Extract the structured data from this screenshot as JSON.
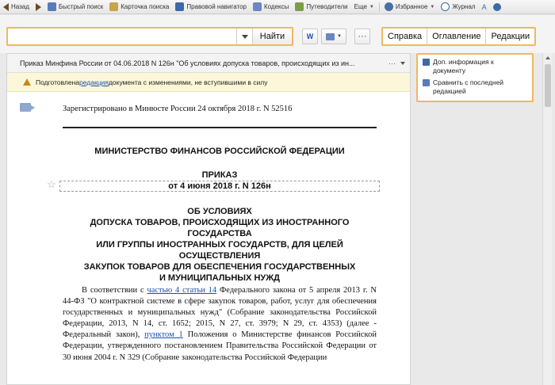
{
  "toolbar": {
    "back": "Назад",
    "quick_search": "Быстрый поиск",
    "search_card": "Карточка поиска",
    "legal_navigator": "Правовой навигатор",
    "codes": "Кодексы",
    "guides": "Путеводители",
    "more": "Еще",
    "favorites": "Избранное",
    "journal": "Журнал",
    "font_size": "A"
  },
  "search": {
    "value": "",
    "find_label": "Найти",
    "word_icon_label": "W"
  },
  "tabs": [
    "Справка",
    "Оглавление",
    "Редакции"
  ],
  "doc_title": "Приказ Минфина России от 04.06.2018 N 126н \"Об условиях допуска товаров, происходящих из ин...",
  "warning": {
    "prefix": "Подготовлена ",
    "link": "редакция",
    "suffix": " документа с изменениями, не вступившими в силу"
  },
  "document": {
    "registered": "Зарегистрировано в Минюсте России 24 октября 2018 г. N 52516",
    "ministry": "МИНИСТЕРСТВО ФИНАНСОВ РОССИЙСКОЙ ФЕДЕРАЦИИ",
    "order": "ПРИКАЗ",
    "order_date": "от 4 июня 2018 г. N 126н",
    "heading_lines": [
      "ОБ УСЛОВИЯХ",
      "ДОПУСКА ТОВАРОВ, ПРОИСХОДЯЩИХ ИЗ ИНОСТРАННОГО",
      "ГОСУДАРСТВА",
      "ИЛИ ГРУППЫ ИНОСТРАННЫХ ГОСУДАРСТВ, ДЛЯ ЦЕЛЕЙ",
      "ОСУЩЕСТВЛЕНИЯ",
      "ЗАКУПОК ТОВАРОВ ДЛЯ ОБЕСПЕЧЕНИЯ ГОСУДАРСТВЕННЫХ",
      "И МУНИЦИПАЛЬНЫХ НУЖД"
    ],
    "para_1": "В соответствии с ",
    "para_link_1": "частью 4 статьи 14",
    "para_2": " Федерального закона от 5 апреля 2013 г. N 44-ФЗ \"О контрактной системе в сфере закупок товаров, работ, услуг для обеспечения государственных и муниципальных нужд\" (Собрание законодательства Российской Федерации, 2013, N 14, ст. 1652; 2015, N 27, ст. 3979; N 29, ст. 4353) (далее - Федеральный закон), ",
    "para_link_2": "пунктом 1",
    "para_3": " Положения о Министерстве финансов Российской Федерации, утвержденного постановлением Правительства Российской Федерации от 30 июня 2004 г. N 329 (Собрание законодательства Российской Федерации"
  },
  "side": {
    "item_1": "Доп. информация к документу",
    "item_2": "Сравнить с последней редакцией"
  },
  "colors": {
    "accent_border": "#f0b860",
    "link": "#1a4db3",
    "warning_bg": "#fbf7d8"
  }
}
